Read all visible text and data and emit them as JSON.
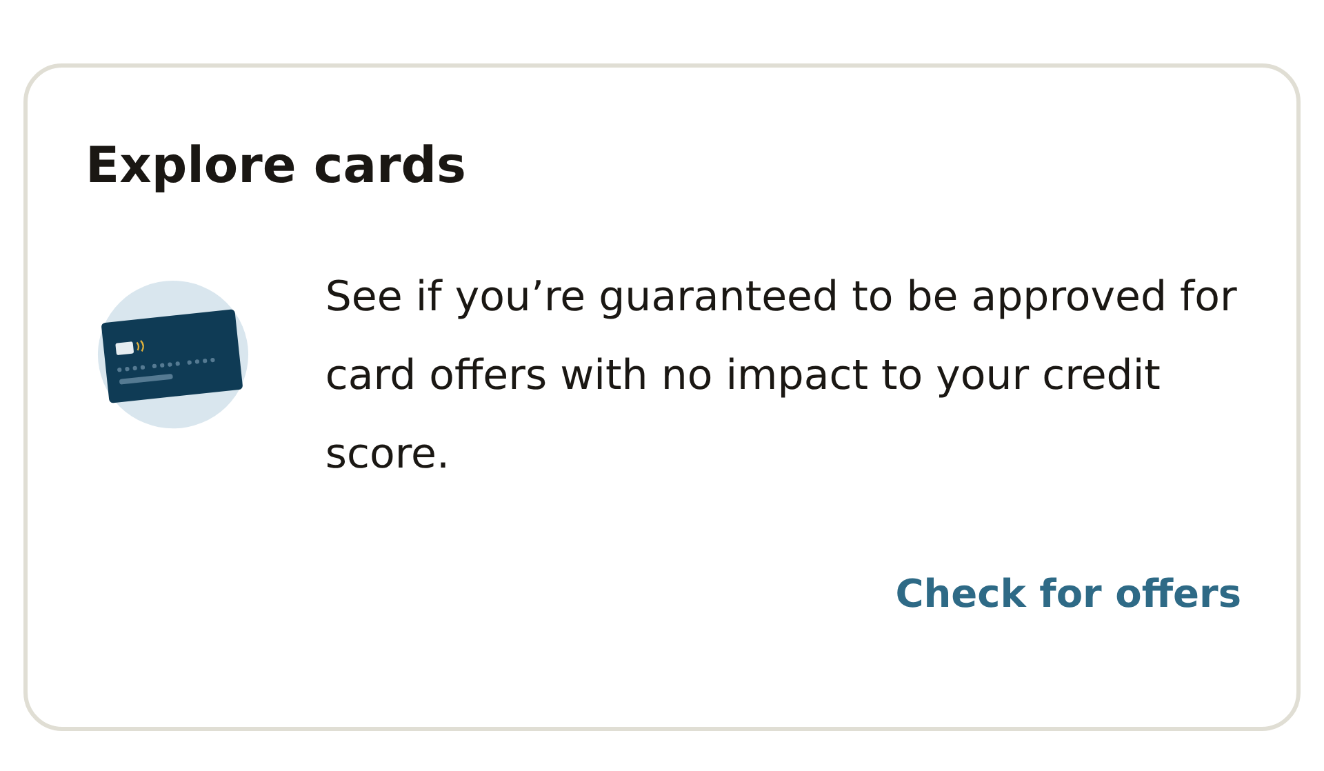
{
  "card": {
    "title": "Explore cards",
    "description": "See if you’re guaranteed to be approved for card offers with no impact to your credit score.",
    "link": "Check for offers"
  }
}
